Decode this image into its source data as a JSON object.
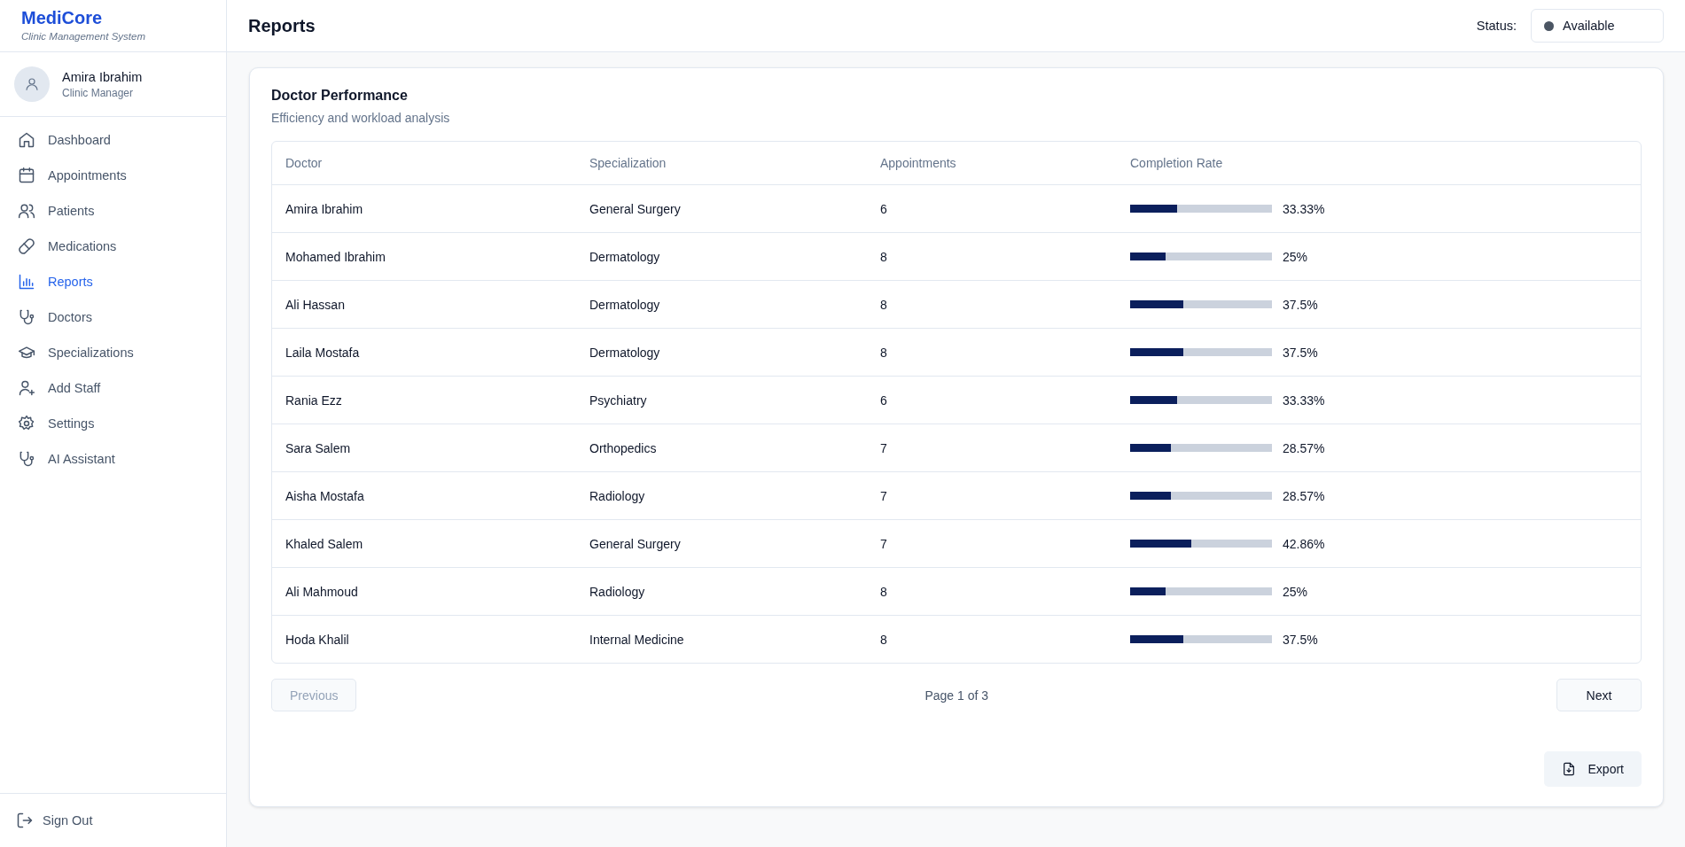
{
  "brand": {
    "name": "MediCore",
    "tagline": "Clinic Management System"
  },
  "user": {
    "name": "Amira Ibrahim",
    "role": "Clinic Manager"
  },
  "nav": [
    {
      "label": "Dashboard",
      "selected": false
    },
    {
      "label": "Appointments",
      "selected": false
    },
    {
      "label": "Patients",
      "selected": false
    },
    {
      "label": "Medications",
      "selected": false
    },
    {
      "label": "Reports",
      "selected": true
    },
    {
      "label": "Doctors",
      "selected": false
    },
    {
      "label": "Specializations",
      "selected": false
    },
    {
      "label": "Add Staff",
      "selected": false
    },
    {
      "label": "Settings",
      "selected": false
    },
    {
      "label": "AI Assistant",
      "selected": false
    }
  ],
  "sign_out": "Sign Out",
  "header": {
    "title": "Reports",
    "status_label": "Status:",
    "status": {
      "value": "Available",
      "color": "#4b5563"
    }
  },
  "card": {
    "title": "Doctor Performance",
    "subtitle": "Efficiency and workload analysis",
    "columns": [
      "Doctor",
      "Specialization",
      "Appointments",
      "Completion Rate"
    ],
    "rows": [
      {
        "doctor": "Amira Ibrahim",
        "specialization": "General Surgery",
        "appointments": "6",
        "level": 0.3333,
        "rate": "33.33%"
      },
      {
        "doctor": "Mohamed Ibrahim",
        "specialization": "Dermatology",
        "appointments": "8",
        "level": 0.25,
        "rate": "25%"
      },
      {
        "doctor": "Ali Hassan",
        "specialization": "Dermatology",
        "appointments": "8",
        "level": 0.375,
        "rate": "37.5%"
      },
      {
        "doctor": "Laila Mostafa",
        "specialization": "Dermatology",
        "appointments": "8",
        "level": 0.375,
        "rate": "37.5%"
      },
      {
        "doctor": "Rania Ezz",
        "specialization": "Psychiatry",
        "appointments": "6",
        "level": 0.3333,
        "rate": "33.33%"
      },
      {
        "doctor": "Sara Salem",
        "specialization": "Orthopedics",
        "appointments": "7",
        "level": 0.2857,
        "rate": "28.57%"
      },
      {
        "doctor": "Aisha Mostafa",
        "specialization": "Radiology",
        "appointments": "7",
        "level": 0.2857,
        "rate": "28.57%"
      },
      {
        "doctor": "Khaled Salem",
        "specialization": "General Surgery",
        "appointments": "7",
        "level": 0.4286,
        "rate": "42.86%"
      },
      {
        "doctor": "Ali Mahmoud",
        "specialization": "Radiology",
        "appointments": "8",
        "level": 0.25,
        "rate": "25%"
      },
      {
        "doctor": "Hoda Khalil",
        "specialization": "Internal Medicine",
        "appointments": "8",
        "level": 0.375,
        "rate": "37.5%"
      }
    ],
    "pagination": {
      "previous": {
        "label": "Previous",
        "disabled": true
      },
      "page": "Page 1 of 3",
      "next": {
        "label": "Next",
        "disabled": false
      }
    },
    "export": "Export"
  }
}
